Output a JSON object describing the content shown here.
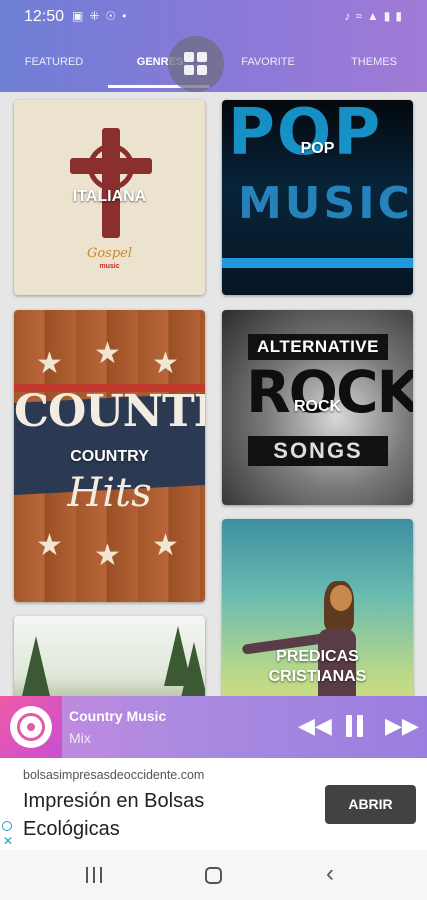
{
  "status": {
    "time": "12:50",
    "left_icons": [
      "image-icon",
      "radio-icon",
      "vpn-icon",
      "dot-icon"
    ],
    "right_icons": [
      "mute-icon",
      "wifi-icon",
      "signal-icon",
      "battery-icon"
    ]
  },
  "tabs": [
    {
      "label": "FEATURED",
      "active": false
    },
    {
      "label": "GENRES",
      "active": true
    },
    {
      "label": "FAVORITE",
      "active": false
    },
    {
      "label": "THEMES",
      "active": false
    }
  ],
  "genres": [
    {
      "caption": "ITALIANA",
      "art_text": "Gospel",
      "art_sub": "music"
    },
    {
      "caption": "POP",
      "art_text": "POP",
      "art_sub": "MUSIC"
    },
    {
      "caption": "COUNTRY",
      "art_text": "COUNTRY",
      "art_sub": "Hits"
    },
    {
      "caption": "ROCK",
      "art_top": "ALTERNATIVE",
      "art_text": "ROCK",
      "art_sub": "SONGS"
    },
    {
      "caption": ""
    },
    {
      "caption": "PREDICAS CRISTIANAS"
    }
  ],
  "player": {
    "title": "Country Music",
    "subtitle": "Mix",
    "accent": "#e25aa8"
  },
  "ad": {
    "url": "bolsasimpresasdeoccidente.com",
    "headline": "Impresión en Bolsas Ecológicas",
    "button": "ABRIR"
  }
}
